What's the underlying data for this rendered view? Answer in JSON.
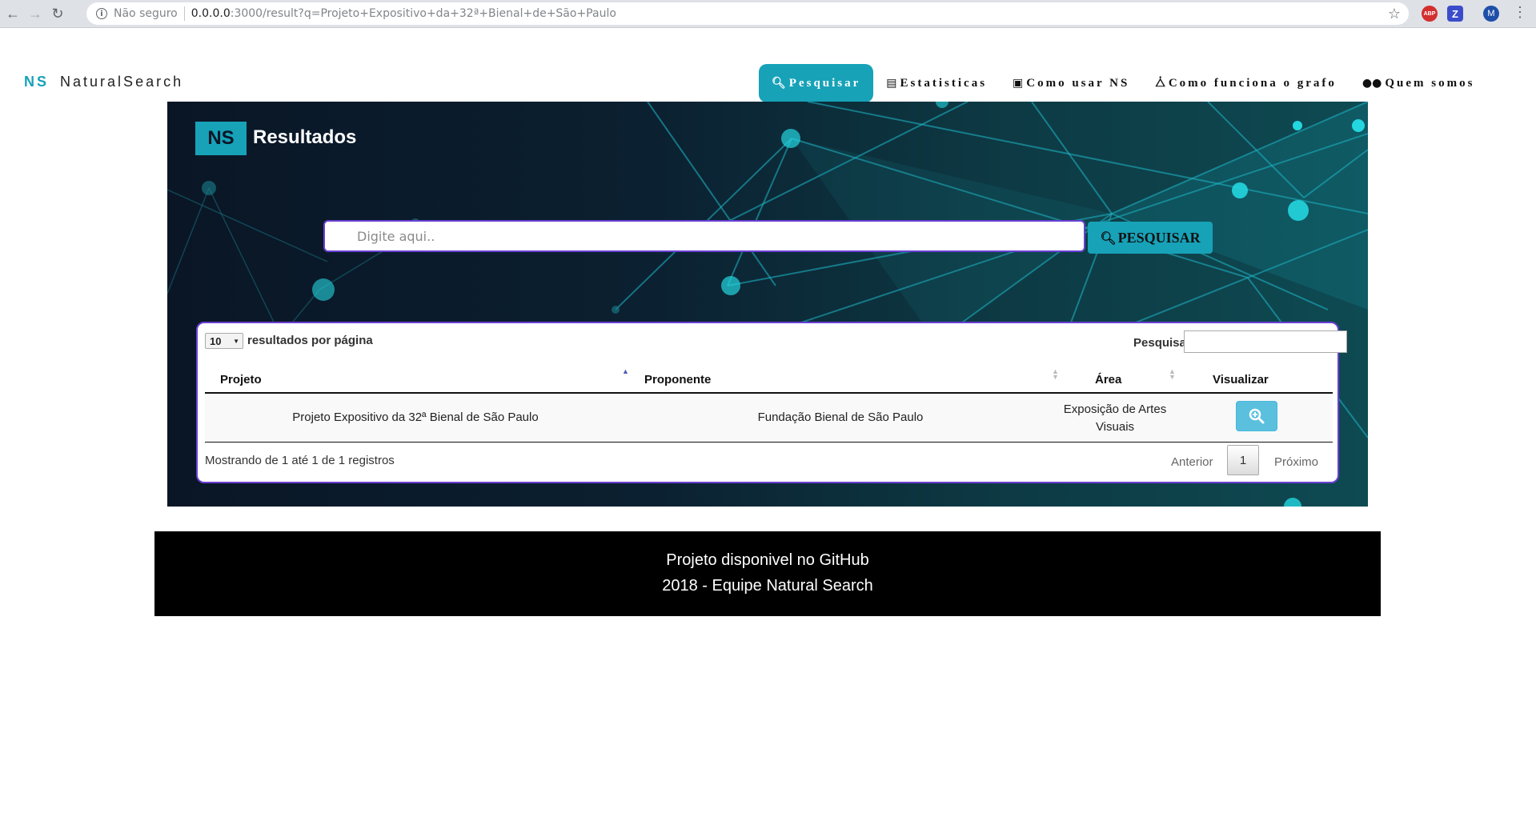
{
  "browser": {
    "security_label": "Não seguro",
    "url_host": "0.0.0.0",
    "url_path": ":3000/result?q=Projeto+Expositivo+da+32ª+Bienal+de+São+Paulo",
    "ext_abp": "ABP",
    "ext_z": "Z",
    "profile_initial": "M"
  },
  "navbar": {
    "brand_ns": "NS",
    "brand_name": "NaturalSearch",
    "links": [
      {
        "label": "Pesquisar",
        "icon": "search-icon"
      },
      {
        "label": "Estatisticas",
        "icon": "bar-chart-icon"
      },
      {
        "label": "Como usar NS",
        "icon": "laptop-icon"
      },
      {
        "label": "Como funciona o grafo",
        "icon": "graph-icon"
      },
      {
        "label": "Quem somos",
        "icon": "users-icon"
      }
    ]
  },
  "hero": {
    "badge": "NS",
    "title": "Resultados",
    "search_placeholder": "Digite aqui..",
    "search_button": "PESQUISAR"
  },
  "table": {
    "page_length": "10",
    "page_length_label": "resultados por página",
    "filter_label": "Pesquisar",
    "columns": [
      "Projeto",
      "Proponente",
      "Área",
      "Visualizar"
    ],
    "rows": [
      {
        "projeto": "Projeto Expositivo da 32ª Bienal de São Paulo",
        "proponente": "Fundação Bienal de São Paulo",
        "area_line1": "Exposição de Artes",
        "area_line2": "Visuais"
      }
    ],
    "info": "Mostrando de 1 até 1 de 1 registros",
    "pager_prev": "Anterior",
    "pager_current": "1",
    "pager_next": "Próximo"
  },
  "footer": {
    "line1": "Projeto disponivel no GitHub",
    "line2": "2018 - Equipe Natural Search"
  },
  "colors": {
    "accent": "#17a2b8",
    "border_purple": "#6a3fd3",
    "view_button": "#5bc0de"
  }
}
